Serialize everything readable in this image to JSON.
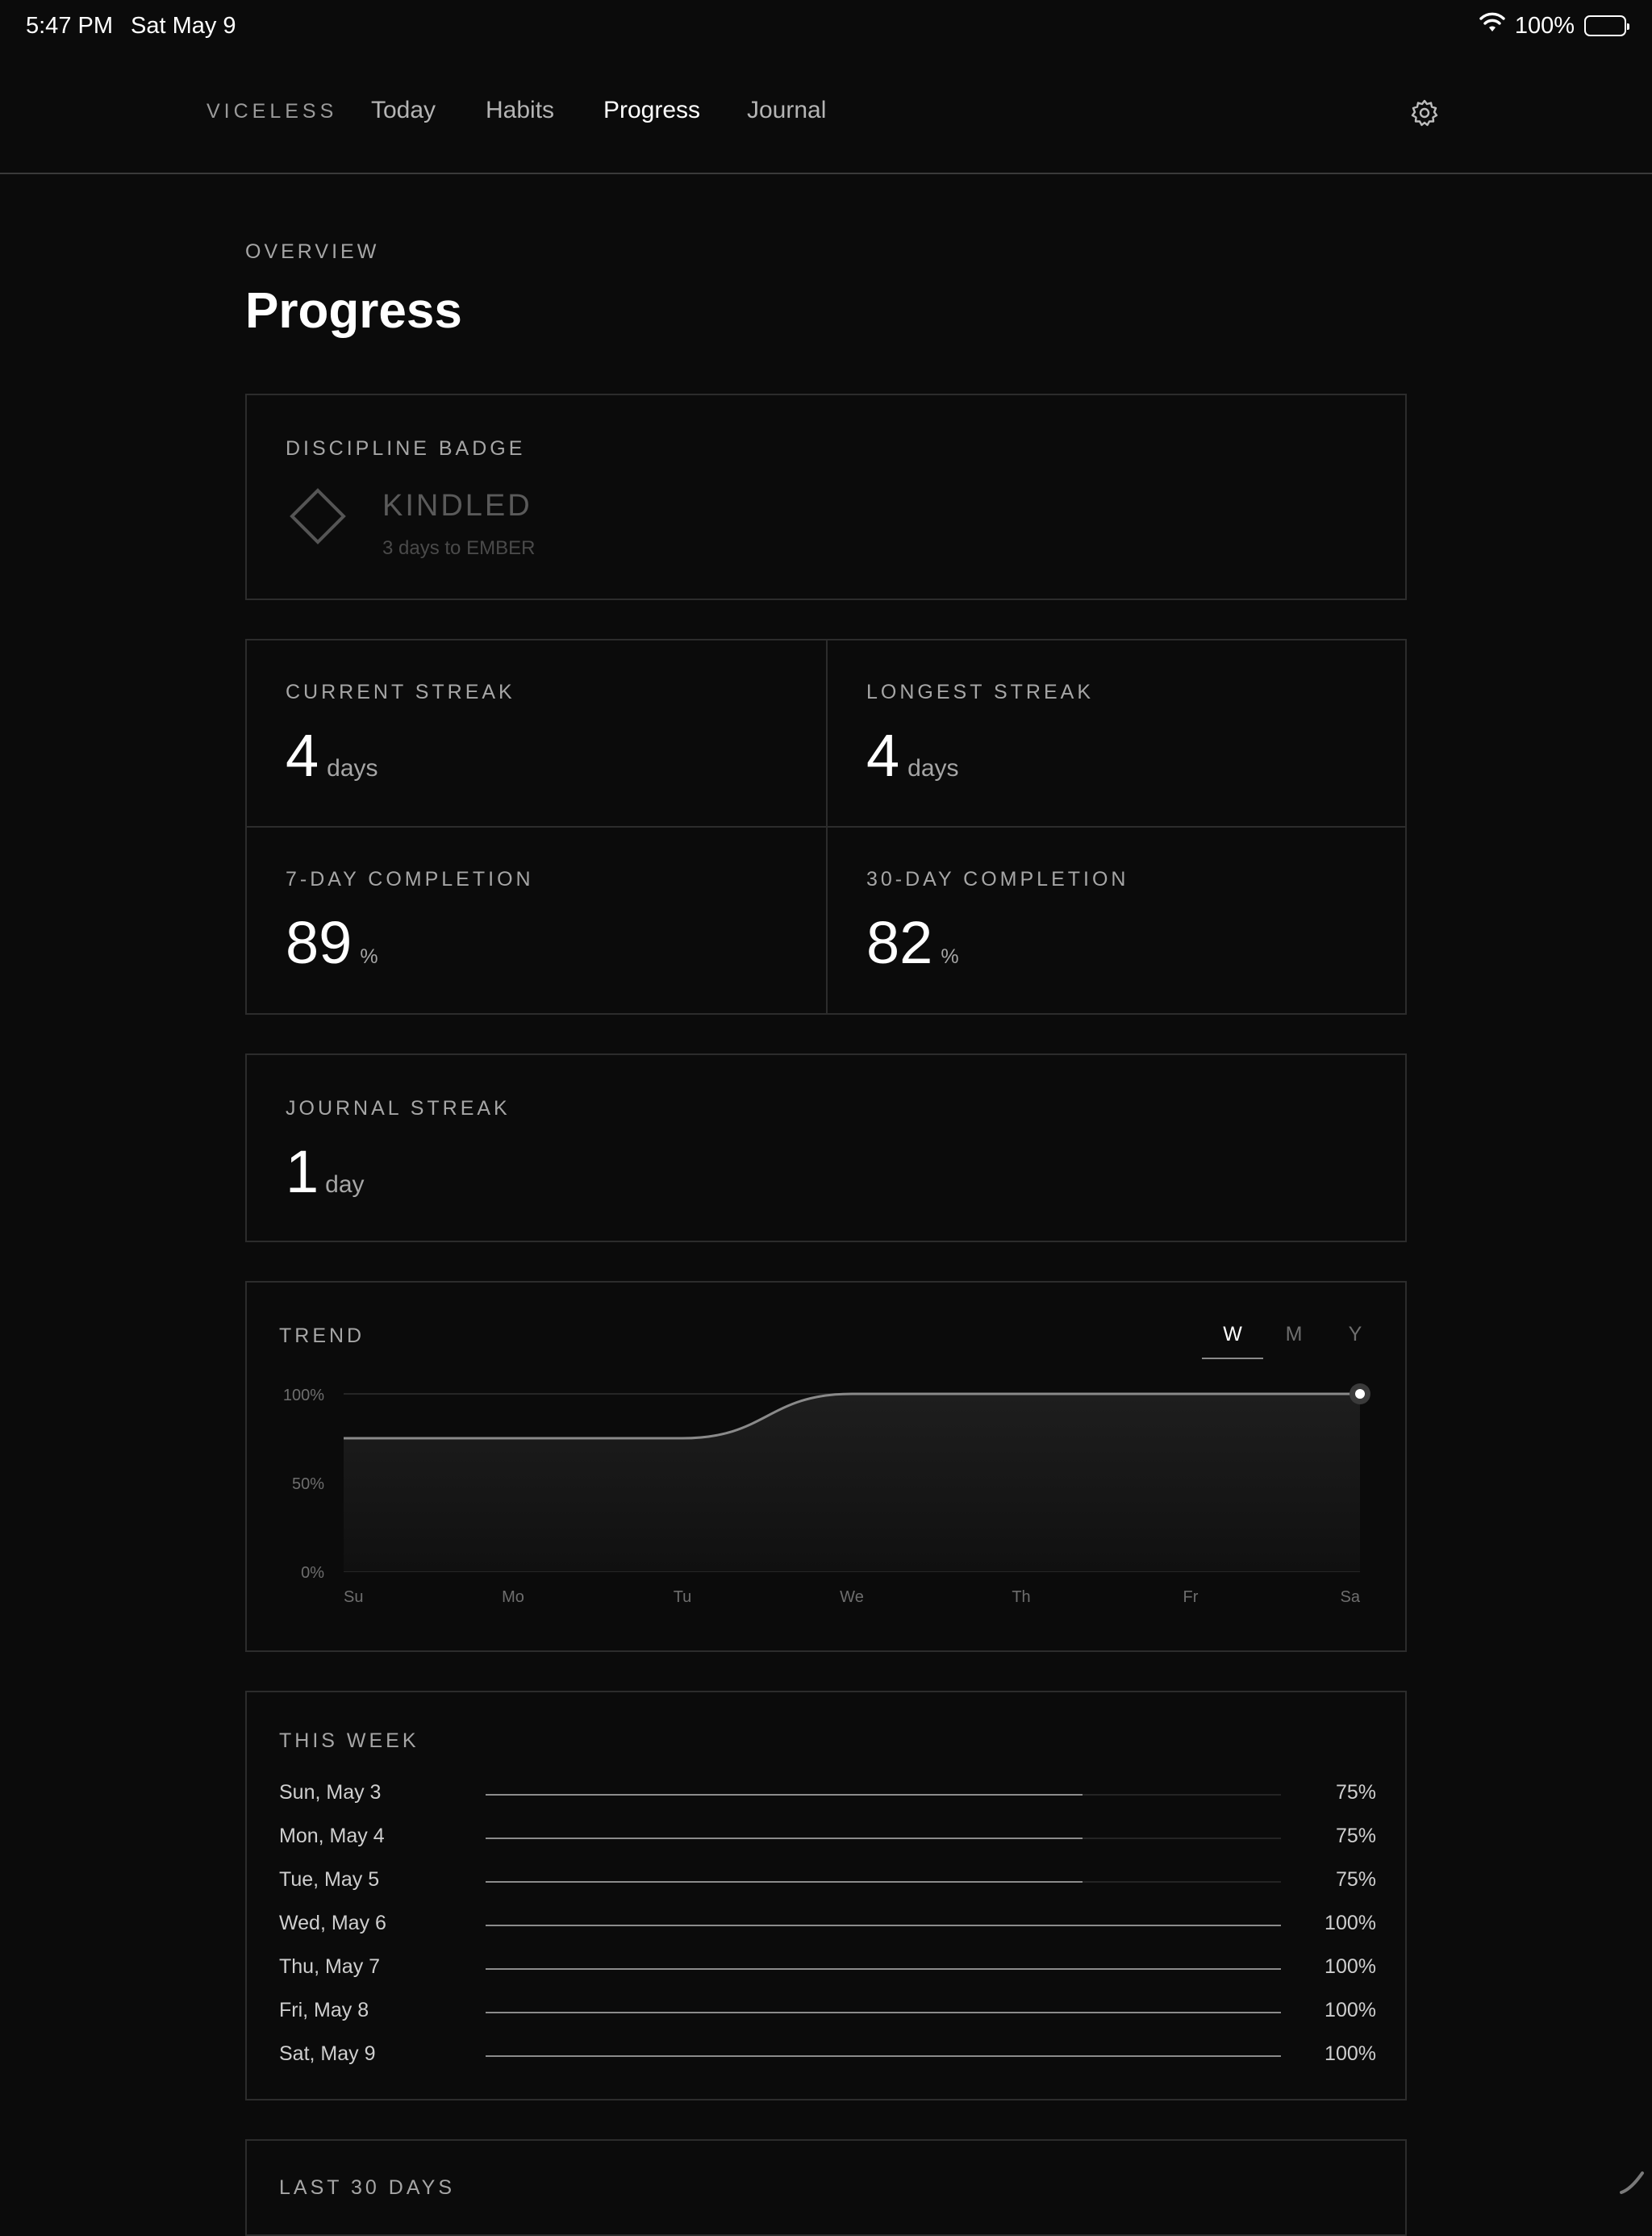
{
  "status_bar": {
    "time": "5:47 PM",
    "date": "Sat May 9",
    "battery": "100%"
  },
  "nav": {
    "brand": "VICELESS",
    "tabs": [
      {
        "label": "Today",
        "active": false
      },
      {
        "label": "Habits",
        "active": false
      },
      {
        "label": "Progress",
        "active": true
      },
      {
        "label": "Journal",
        "active": false
      }
    ],
    "settings_icon": "gear-icon"
  },
  "header": {
    "overline": "OVERVIEW",
    "title": "Progress"
  },
  "badge": {
    "label": "DISCIPLINE BADGE",
    "icon": "diamond-icon",
    "name": "KINDLED",
    "subtitle": "3 days to EMBER"
  },
  "stats": {
    "current_streak": {
      "label": "CURRENT STREAK",
      "value": "4",
      "unit": "days"
    },
    "longest_streak": {
      "label": "LONGEST STREAK",
      "value": "4",
      "unit": "days"
    },
    "completion_7": {
      "label": "7-DAY COMPLETION",
      "value": "89",
      "unit": "%"
    },
    "completion_30": {
      "label": "30-DAY COMPLETION",
      "value": "82",
      "unit": "%"
    }
  },
  "journal_streak": {
    "label": "JOURNAL STREAK",
    "value": "1",
    "unit": "day"
  },
  "trend": {
    "label": "TREND",
    "ranges": [
      {
        "label": "W",
        "active": true
      },
      {
        "label": "M",
        "active": false
      },
      {
        "label": "Y",
        "active": false
      }
    ]
  },
  "chart_data": {
    "type": "area",
    "title": "TREND",
    "categories": [
      "Su",
      "Mo",
      "Tu",
      "We",
      "Th",
      "Fr",
      "Sa"
    ],
    "values": [
      75,
      75,
      75,
      100,
      100,
      100,
      100
    ],
    "ylim": [
      0,
      100
    ],
    "yticks": [
      "100%",
      "50%",
      "0%"
    ],
    "grid": true,
    "colors": {
      "line": "#8a8a8a",
      "fill": "#1a1a1a",
      "grid": "#262626"
    }
  },
  "this_week": {
    "label": "THIS WEEK",
    "rows": [
      {
        "day": "Sun, May 3",
        "pct": "75%",
        "value": 0.75
      },
      {
        "day": "Mon, May 4",
        "pct": "75%",
        "value": 0.75
      },
      {
        "day": "Tue, May 5",
        "pct": "75%",
        "value": 0.75
      },
      {
        "day": "Wed, May 6",
        "pct": "100%",
        "value": 1.0
      },
      {
        "day": "Thu, May 7",
        "pct": "100%",
        "value": 1.0
      },
      {
        "day": "Fri, May 8",
        "pct": "100%",
        "value": 1.0
      },
      {
        "day": "Sat, May 9",
        "pct": "100%",
        "value": 1.0
      }
    ]
  },
  "last_30_days": {
    "label": "LAST 30 DAYS"
  }
}
